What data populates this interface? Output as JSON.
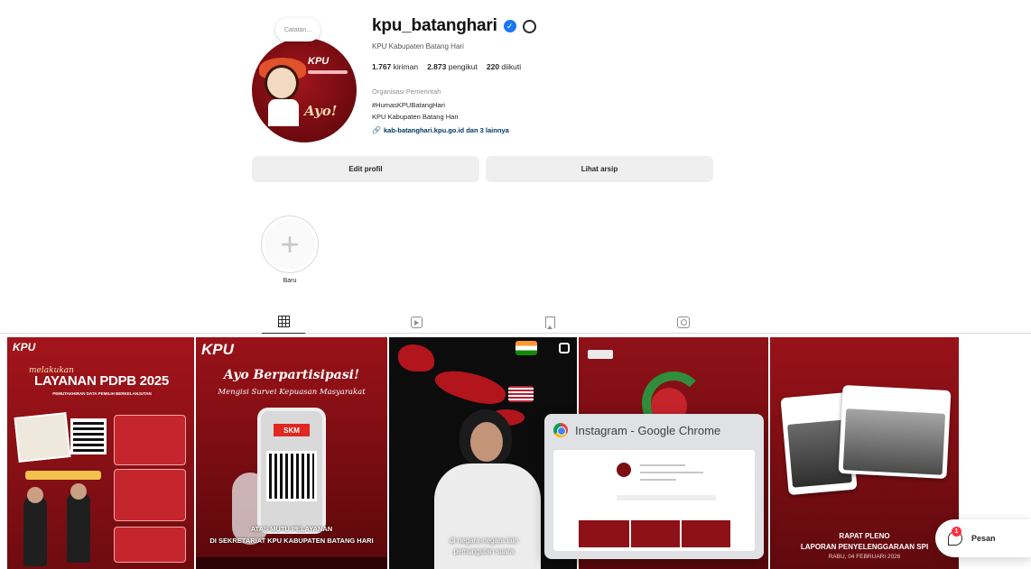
{
  "profile": {
    "username": "kpu_batanghari",
    "full_name": "KPU Kabupaten Batang Hari",
    "note_placeholder": "Catatan...",
    "stats": {
      "posts": "1.767",
      "posts_label": "kiriman",
      "followers": "2.873",
      "followers_label": "pengikut",
      "following": "220",
      "following_label": "diikuti"
    },
    "category": "Organisasi Pemerintah",
    "bio_line1": "#HumasKPUBatangHari",
    "bio_line2": "KPU Kabupaten Batang Hari",
    "link_text": "kab-batanghari.kpu.go.id dan 3 lainnya",
    "avatar_logo_text": "KPU",
    "avatar_script_text": "Ayo!"
  },
  "buttons": {
    "edit_profile": "Edit profil",
    "view_archive": "Lihat arsip"
  },
  "highlight": {
    "new_label": "Baru"
  },
  "tabs": [
    {
      "name": "posts",
      "icon": "grid-icon",
      "active": true
    },
    {
      "name": "reels",
      "icon": "reels-icon",
      "active": false
    },
    {
      "name": "saved",
      "icon": "bookmark-icon",
      "active": false
    },
    {
      "name": "tagged",
      "icon": "tagged-icon",
      "active": false
    }
  ],
  "posts": {
    "p1": {
      "brand": "KPU",
      "small": "melakukan",
      "title": "LAYANAN PDPB 2025",
      "subtitle": "PEMUTAKHIRAN DATA PEMILIH BERKELANJUTAN"
    },
    "p2": {
      "brand": "KPU",
      "title": "Ayo Berpartisipasi!",
      "subtitle": "Mengisi Survei Kepuasan Masyarakat",
      "badge": "SKM",
      "footer_line1": "ATAS MUTU PELAYANAN",
      "footer_line2": "DI SEKRETARIAT KPU KABUPATEN BATANG HARI"
    },
    "p3": {
      "caption_line1": "di negara-negara lain",
      "caption_line2": "pemungutan suara"
    },
    "p5": {
      "title_line1": "RAPAT PLENO",
      "title_line2": "LAPORAN PENYELENGGARAAN SPI",
      "date": "RABU, 04 FEBRUARI 2026"
    }
  },
  "chrome_preview": {
    "title": "Instagram - Google Chrome"
  },
  "messages": {
    "label": "Pesan",
    "badge_count": "1"
  },
  "colors": {
    "brand_red": "#8f1118",
    "verified_blue": "#1877f2",
    "link_blue": "#00376b",
    "button_gray": "#efefef"
  }
}
